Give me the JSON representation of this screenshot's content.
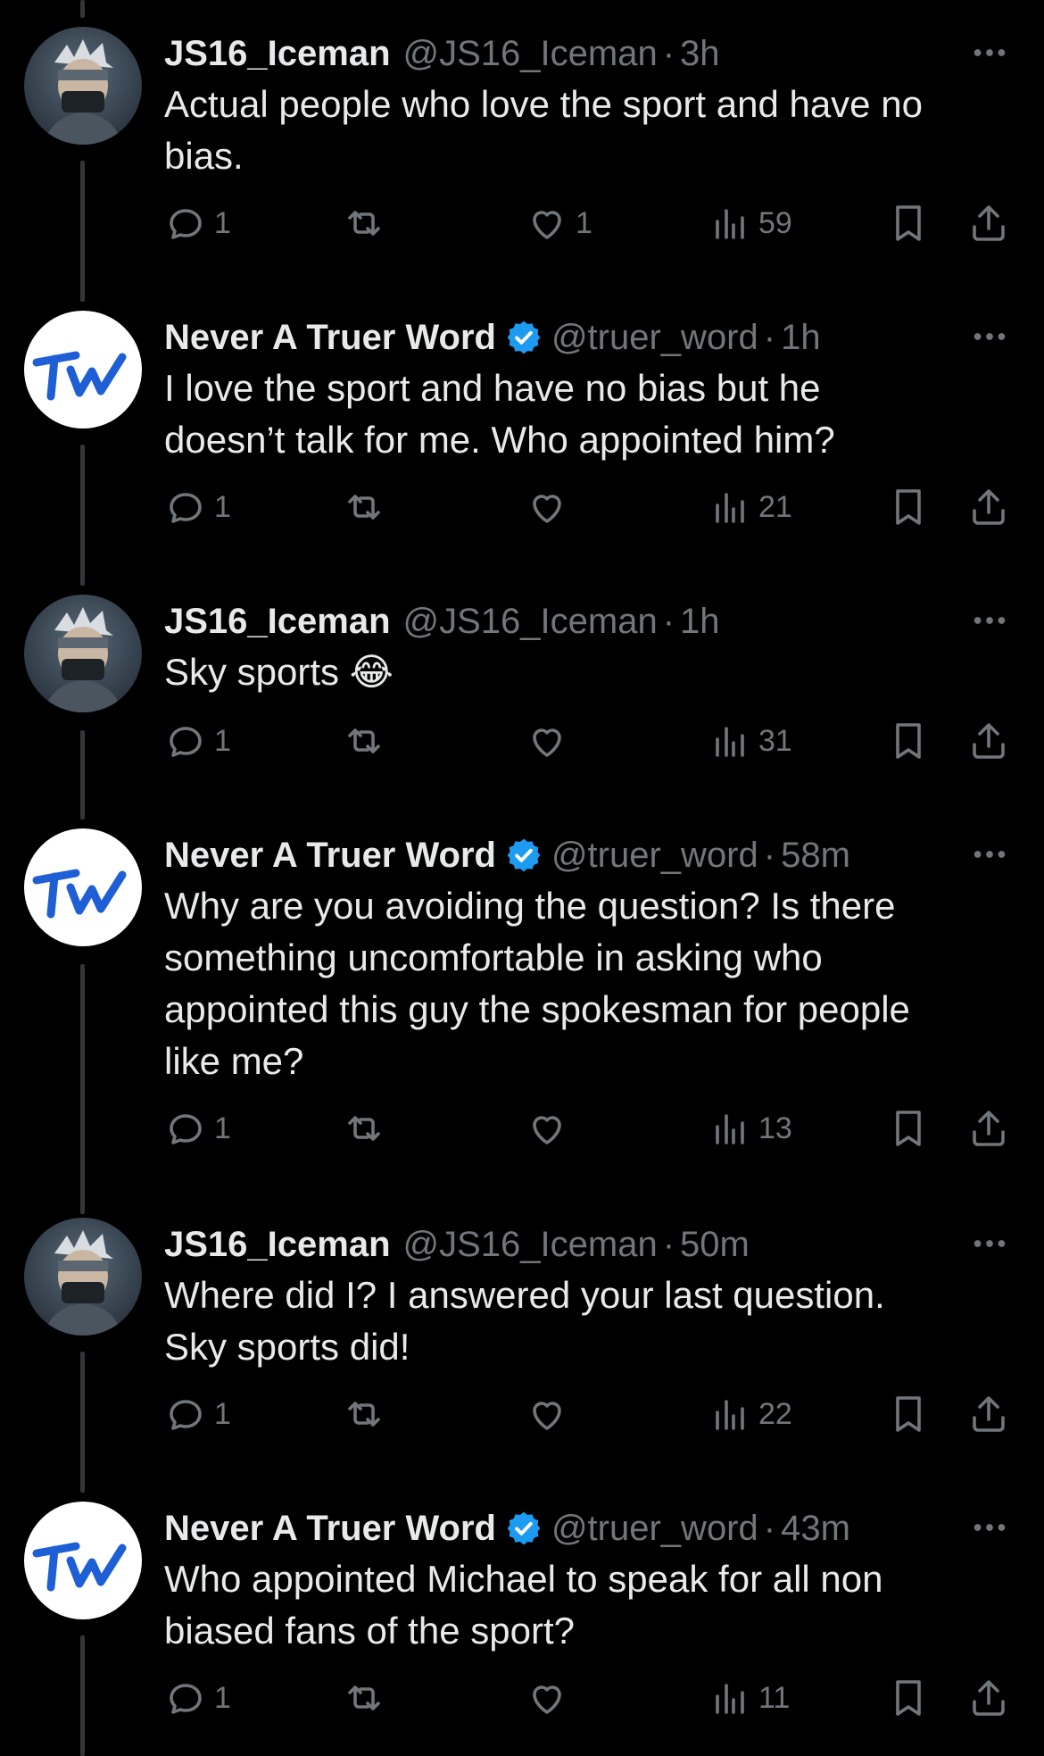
{
  "tweets": [
    {
      "name": "JS16_Iceman",
      "handle": "@JS16_Iceman",
      "sep": "·",
      "time": "3h",
      "verified": false,
      "avatar": "iceman-avatar",
      "text": "Actual people who love the sport and have no\nbias.",
      "replies": "1",
      "retweets": "",
      "likes": "1",
      "views": "59"
    },
    {
      "name": "Never A Truer Word",
      "handle": "@truer_word",
      "sep": "·",
      "time": "1h",
      "verified": true,
      "avatar": "tw-logo-avatar",
      "text": "I love the sport and have no bias but he\ndoesn’t talk for me. Who appointed him?",
      "replies": "1",
      "retweets": "",
      "likes": "",
      "views": "21"
    },
    {
      "name": "JS16_Iceman",
      "handle": "@JS16_Iceman",
      "sep": "·",
      "time": "1h",
      "verified": false,
      "avatar": "iceman-avatar",
      "text": "Sky sports 😂",
      "replies": "1",
      "retweets": "",
      "likes": "",
      "views": "31"
    },
    {
      "name": "Never A Truer Word",
      "handle": "@truer_word",
      "sep": "·",
      "time": "58m",
      "verified": true,
      "avatar": "tw-logo-avatar",
      "text": "Why are you avoiding the question? Is there\nsomething uncomfortable in asking who\nappointed this guy the spokesman for people\nlike me?",
      "replies": "1",
      "retweets": "",
      "likes": "",
      "views": "13"
    },
    {
      "name": "JS16_Iceman",
      "handle": "@JS16_Iceman",
      "sep": "·",
      "time": "50m",
      "verified": false,
      "avatar": "iceman-avatar",
      "text": "Where did I? I answered your last question.\nSky sports did!",
      "replies": "1",
      "retweets": "",
      "likes": "",
      "views": "22"
    },
    {
      "name": "Never A Truer Word",
      "handle": "@truer_word",
      "sep": "·",
      "time": "43m",
      "verified": true,
      "avatar": "tw-logo-avatar",
      "text": "Who appointed Michael to speak for all non\nbiased fans of the sport?",
      "replies": "1",
      "retweets": "",
      "likes": "",
      "views": "11"
    }
  ],
  "colors": {
    "background": "#000000",
    "text": "#e7e9ea",
    "muted": "#71767b",
    "verified": "#1d9bf0",
    "thread_line": "#333639"
  },
  "icons": [
    "reply-icon",
    "retweet-icon",
    "like-icon",
    "views-icon",
    "bookmark-icon",
    "share-icon",
    "more-icon",
    "verified-badge-icon"
  ]
}
